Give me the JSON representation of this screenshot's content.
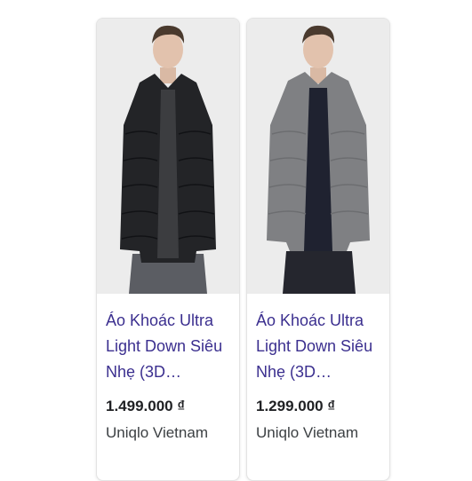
{
  "products": [
    {
      "title": "Áo Khoác Ultra Light Down Siêu Nhẹ (3D…",
      "price": "1.499.000 ₫",
      "seller": "Uniqlo Vietnam",
      "image_icon": "jacket-photo-black",
      "jacket_color": "#232427"
    },
    {
      "title": "Áo Khoác Ultra Light Down Siêu Nhẹ (3D…",
      "price": "1.299.000 ₫",
      "seller": "Uniqlo Vietnam",
      "image_icon": "jacket-photo-gray",
      "jacket_color": "#7f8083"
    }
  ]
}
